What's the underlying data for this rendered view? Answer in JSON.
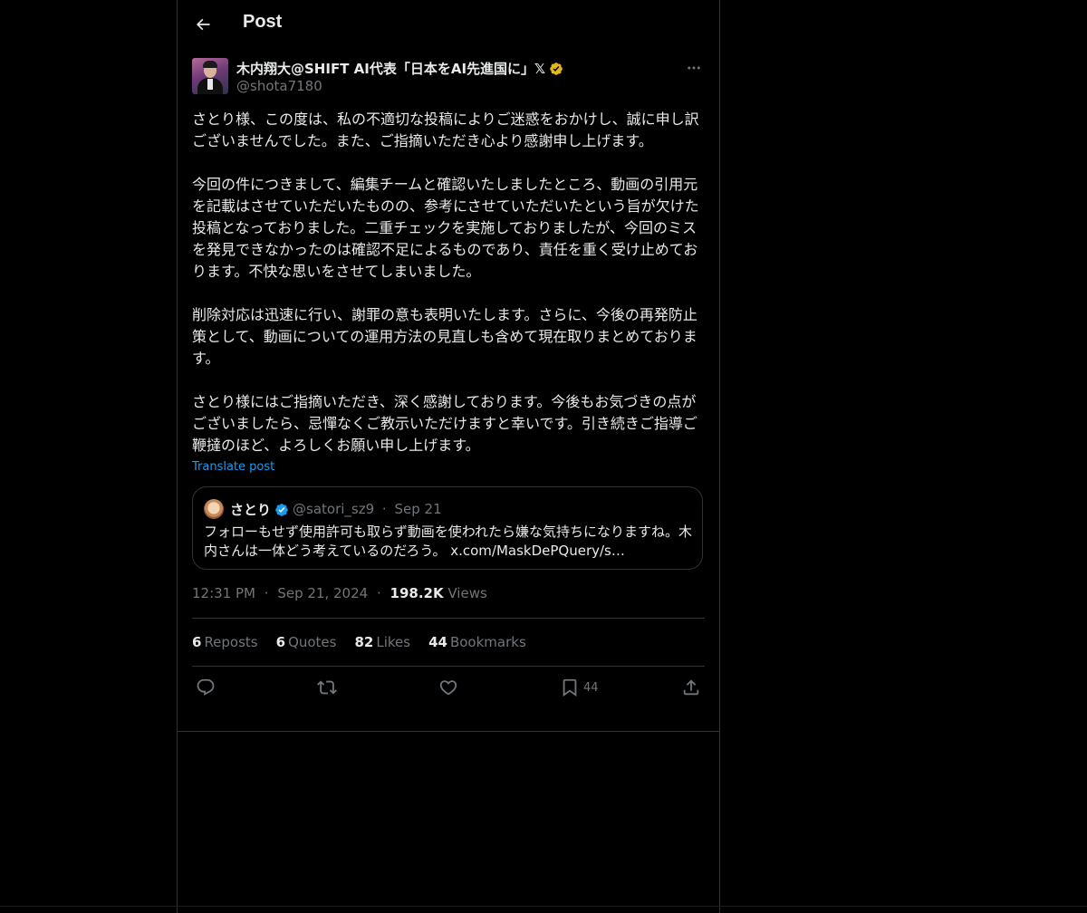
{
  "header": {
    "title": "Post"
  },
  "author": {
    "name": "木内翔大@SHIFT AI代表「日本をAI先進国に」𝕏",
    "handle": "@shota7180"
  },
  "post": {
    "text": "さとり様、この度は、私の不適切な投稿によりご迷惑をおかけし、誠に申し訳ございませんでした。また、ご指摘いただき心より感謝申し上げます。\n\n今回の件につきまして、編集チームと確認いたしましたところ、動画の引用元を記載はさせていただいたものの、参考にさせていただいたという旨が欠けた投稿となっておりました。二重チェックを実施しておりましたが、今回のミスを発見できなかったのは確認不足によるものであり、責任を重く受け止めております。不快な思いをさせてしまいました。\n\n削除対応は迅速に行い、謝罪の意も表明いたします。さらに、今後の再発防止策として、動画についての運用方法の見直しも含めて現在取りまとめております。\n\nさとり様にはご指摘いただき、深く感謝しております。今後もお気づきの点がございましたら、忌憚なくご教示いただけますと幸いです。引き続きご指導ご鞭撻のほど、よろしくお願い申し上げます。",
    "translate_label": "Translate post"
  },
  "quote": {
    "name": "さとり",
    "handle": "@satori_sz9",
    "separator": "·",
    "date": "Sep 21",
    "text": "フォローもせず使用許可も取らず動画を使われたら嫌な気持ちになりますね。木内さんは一体どう考えているのだろう。 x.com/MaskDePQuery/s…"
  },
  "meta": {
    "time": "12:31 PM",
    "separator": "·",
    "date": "Sep 21, 2024",
    "views_count": "198.2K",
    "views_label": "Views"
  },
  "stats": {
    "reposts_count": "6",
    "reposts_label": "Reposts",
    "quotes_count": "6",
    "quotes_label": "Quotes",
    "likes_count": "82",
    "likes_label": "Likes",
    "bookmarks_count": "44",
    "bookmarks_label": "Bookmarks"
  },
  "actions": {
    "bookmark_count": "44"
  },
  "icons": {
    "back": "arrow-left-icon",
    "more": "more-horizontal-icon",
    "verified_gold": "verified-gold-icon",
    "verified_blue": "verified-blue-icon",
    "reply": "reply-icon",
    "repost": "repost-icon",
    "like": "heart-icon",
    "bookmark": "bookmark-icon",
    "share": "share-icon"
  },
  "colors": {
    "background": "#000000",
    "text": "#e7e9ea",
    "muted": "#71767b",
    "border": "#2f3336",
    "link": "#1d9bf0",
    "gold": "#e2b719",
    "blue": "#1d9bf0"
  }
}
